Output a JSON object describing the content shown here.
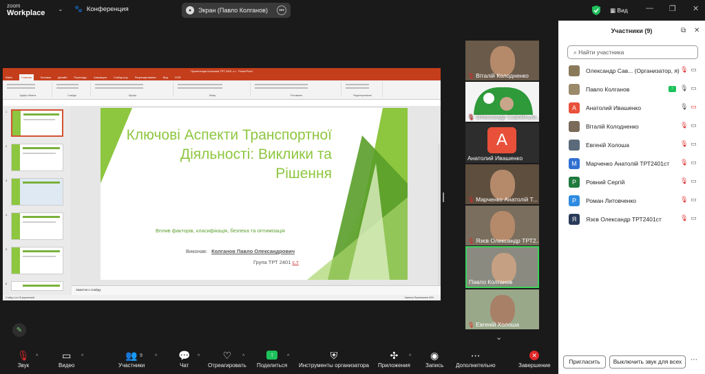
{
  "app": {
    "logo_small": "zoom",
    "logo_big": "Workplace",
    "meeting_label": "Конференция",
    "screen_pill": "Экран (Павло Колганов)",
    "view_label": "Вид"
  },
  "colors": {
    "accent_green": "#1ec25d",
    "mute_red": "#e02828",
    "slide_green": "#8dc63f",
    "ppt_red": "#c43e1c"
  },
  "slide": {
    "title": "Ключові Аспекти Транспортної Діяльності: Виклики та Рішення",
    "subtitle": "Вплив факторів, класифікація, безпека та оптимізація",
    "author_prefix": "Виконав:",
    "author": "Колганов Павло Олександрович",
    "group": "Група ТРТ 2401",
    "group_suffix": "с.т",
    "notes_placeholder": "Заметки к слайду",
    "status_left": "Слайд 1 из 18   украинский",
    "status_right": "Заметки   Примечания   62%"
  },
  "ppt": {
    "window_title": "Презентація Колганов ТРТ 2401 с.т - PowerPoint",
    "tabs": [
      "Файл",
      "Главная",
      "Вставка",
      "Дизайн",
      "Переходы",
      "Анимация",
      "Слайд-шоу",
      "Рецензирование",
      "Вид",
      "XOR"
    ],
    "groups": [
      "Буфер обмена",
      "Слайды",
      "Шрифт",
      "Абзац",
      "Рисование",
      "Редактирование"
    ]
  },
  "video_tiles": [
    {
      "name": "Віталій Колодненко",
      "muted": true
    },
    {
      "name": "Олександр Савойськи...",
      "muted": true
    },
    {
      "name": "Анатолий Ивашенко",
      "muted": false
    },
    {
      "name": "Марченко Анатолій Т...",
      "muted": true
    },
    {
      "name": "Язєв Олександр ТРТ2...",
      "muted": true
    },
    {
      "name": "Павло Колганов",
      "muted": false
    },
    {
      "name": "Евгеній Холоша",
      "muted": true
    }
  ],
  "toolbar": {
    "audio": "Звук",
    "video": "Видео",
    "participants": "Участники",
    "participants_count": "9",
    "chat": "Чат",
    "react": "Отреагировать",
    "share": "Поделиться",
    "host_tools": "Инструменты организатора",
    "apps": "Приложения",
    "record": "Запись",
    "more": "Дополнительно",
    "end": "Завершение"
  },
  "panel": {
    "title": "Участники (9)",
    "search_placeholder": "Найти участника",
    "invite": "Пригласить",
    "mute_all": "Выключить звук для всех",
    "participants": [
      {
        "name": "Олександр Сав...  (Организатор, я)",
        "avatar": "",
        "avatar_color": "#8a7a5a",
        "mic": "off",
        "cam": "on"
      },
      {
        "name": "Павло Колганов",
        "avatar": "",
        "avatar_color": "#9a8a6a",
        "mic": "on",
        "cam": "on",
        "sharing": true
      },
      {
        "name": "Анатолий Ивашенко",
        "avatar": "А",
        "avatar_color": "#e8503a",
        "mic": "on",
        "cam": "off"
      },
      {
        "name": "Віталій Колодненко",
        "avatar": "",
        "avatar_color": "#7a6a5a",
        "mic": "off",
        "cam": "on"
      },
      {
        "name": "Евгеній Холоша",
        "avatar": "",
        "avatar_color": "#5a6a7a",
        "mic": "off",
        "cam": "on"
      },
      {
        "name": "Марченко Анатолій ТРТ2401ст",
        "avatar": "М",
        "avatar_color": "#2f6fd1",
        "mic": "off",
        "cam": "on"
      },
      {
        "name": "Ровний Сергій",
        "avatar": "Р",
        "avatar_color": "#1f7a3e",
        "mic": "off",
        "cam": "on"
      },
      {
        "name": "Роман Литовченко",
        "avatar": "Р",
        "avatar_color": "#2f8be0",
        "mic": "off",
        "cam": "on"
      },
      {
        "name": "Язєв Олександр ТРТ2401ст",
        "avatar": "Я",
        "avatar_color": "#2a3a5a",
        "mic": "off",
        "cam": "on"
      }
    ]
  }
}
